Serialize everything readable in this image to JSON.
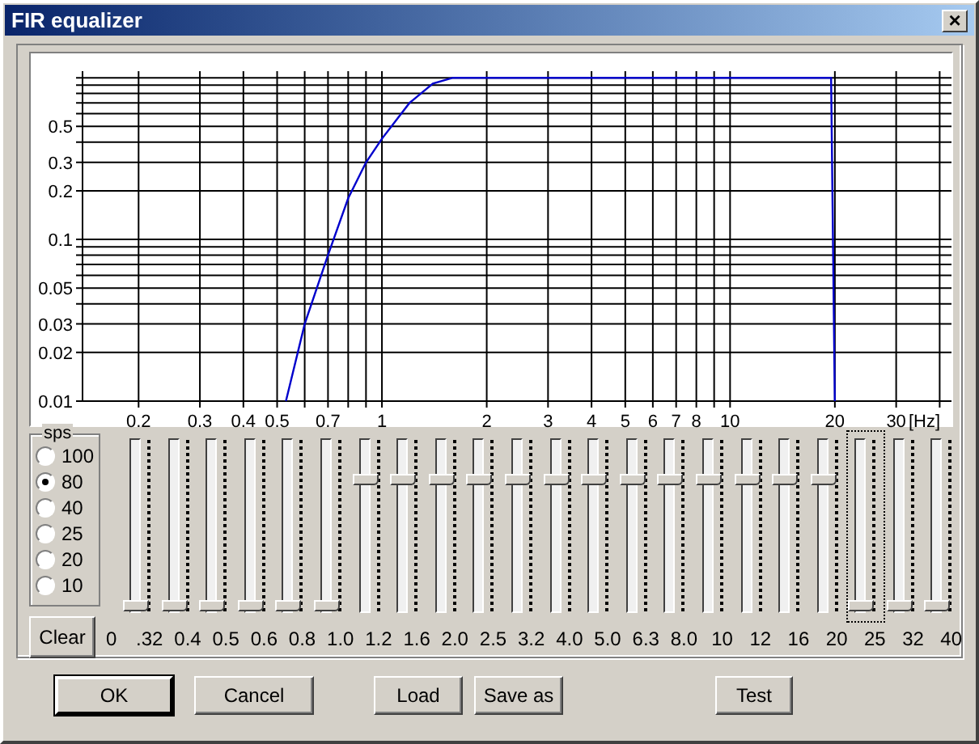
{
  "window": {
    "title": "FIR equalizer",
    "close": "×"
  },
  "chart": {
    "y_axis_labels": [
      "0.5",
      "0.3",
      "0.2",
      "0.1",
      "0.05",
      "0.03",
      "0.02",
      "0.01"
    ],
    "x_axis_labels": [
      "0.2",
      "0.3",
      "0.4",
      "0.5",
      "0.7",
      "1",
      "2",
      "3",
      "4",
      "5",
      "6",
      "7",
      "8",
      "10",
      "20",
      "30"
    ],
    "unit": "[Hz]"
  },
  "sps": {
    "title": "sps",
    "options": [
      {
        "label": "100",
        "selected": false
      },
      {
        "label": "80",
        "selected": true
      },
      {
        "label": "40",
        "selected": false
      },
      {
        "label": "25",
        "selected": false
      },
      {
        "label": "20",
        "selected": false
      },
      {
        "label": "10",
        "selected": false
      }
    ]
  },
  "sliders": [
    {
      "level": 0,
      "focused": false
    },
    {
      "level": 0,
      "focused": false
    },
    {
      "level": 0,
      "focused": false
    },
    {
      "level": 0,
      "focused": false
    },
    {
      "level": 0,
      "focused": false
    },
    {
      "level": 0,
      "focused": false
    },
    {
      "level": 0.78,
      "focused": false
    },
    {
      "level": 0.78,
      "focused": false
    },
    {
      "level": 0.78,
      "focused": false
    },
    {
      "level": 0.78,
      "focused": false
    },
    {
      "level": 0.78,
      "focused": false
    },
    {
      "level": 0.78,
      "focused": false
    },
    {
      "level": 0.78,
      "focused": false
    },
    {
      "level": 0.78,
      "focused": false
    },
    {
      "level": 0.78,
      "focused": false
    },
    {
      "level": 0.78,
      "focused": false
    },
    {
      "level": 0.78,
      "focused": false
    },
    {
      "level": 0.78,
      "focused": false
    },
    {
      "level": 0.78,
      "focused": false
    },
    {
      "level": 0,
      "focused": true
    },
    {
      "level": 0,
      "focused": false
    },
    {
      "level": 0,
      "focused": false
    }
  ],
  "band_labels": [
    "0",
    ".32",
    "0.4",
    "0.5",
    "0.6",
    "0.8",
    "1.0",
    "1.2",
    "1.6",
    "2.0",
    "2.5",
    "3.2",
    "4.0",
    "5.0",
    "6.3",
    "8.0",
    "10",
    "12",
    "16",
    "20",
    "25",
    "32",
    "40"
  ],
  "clear_button": "Clear",
  "buttons": [
    {
      "label": "OK",
      "kind": "default"
    },
    {
      "label": "Cancel",
      "kind": "normal"
    },
    {
      "label": "Load",
      "kind": "normal"
    },
    {
      "label": "Save as",
      "kind": "normal"
    },
    {
      "label": "Test",
      "kind": "normal"
    }
  ]
}
